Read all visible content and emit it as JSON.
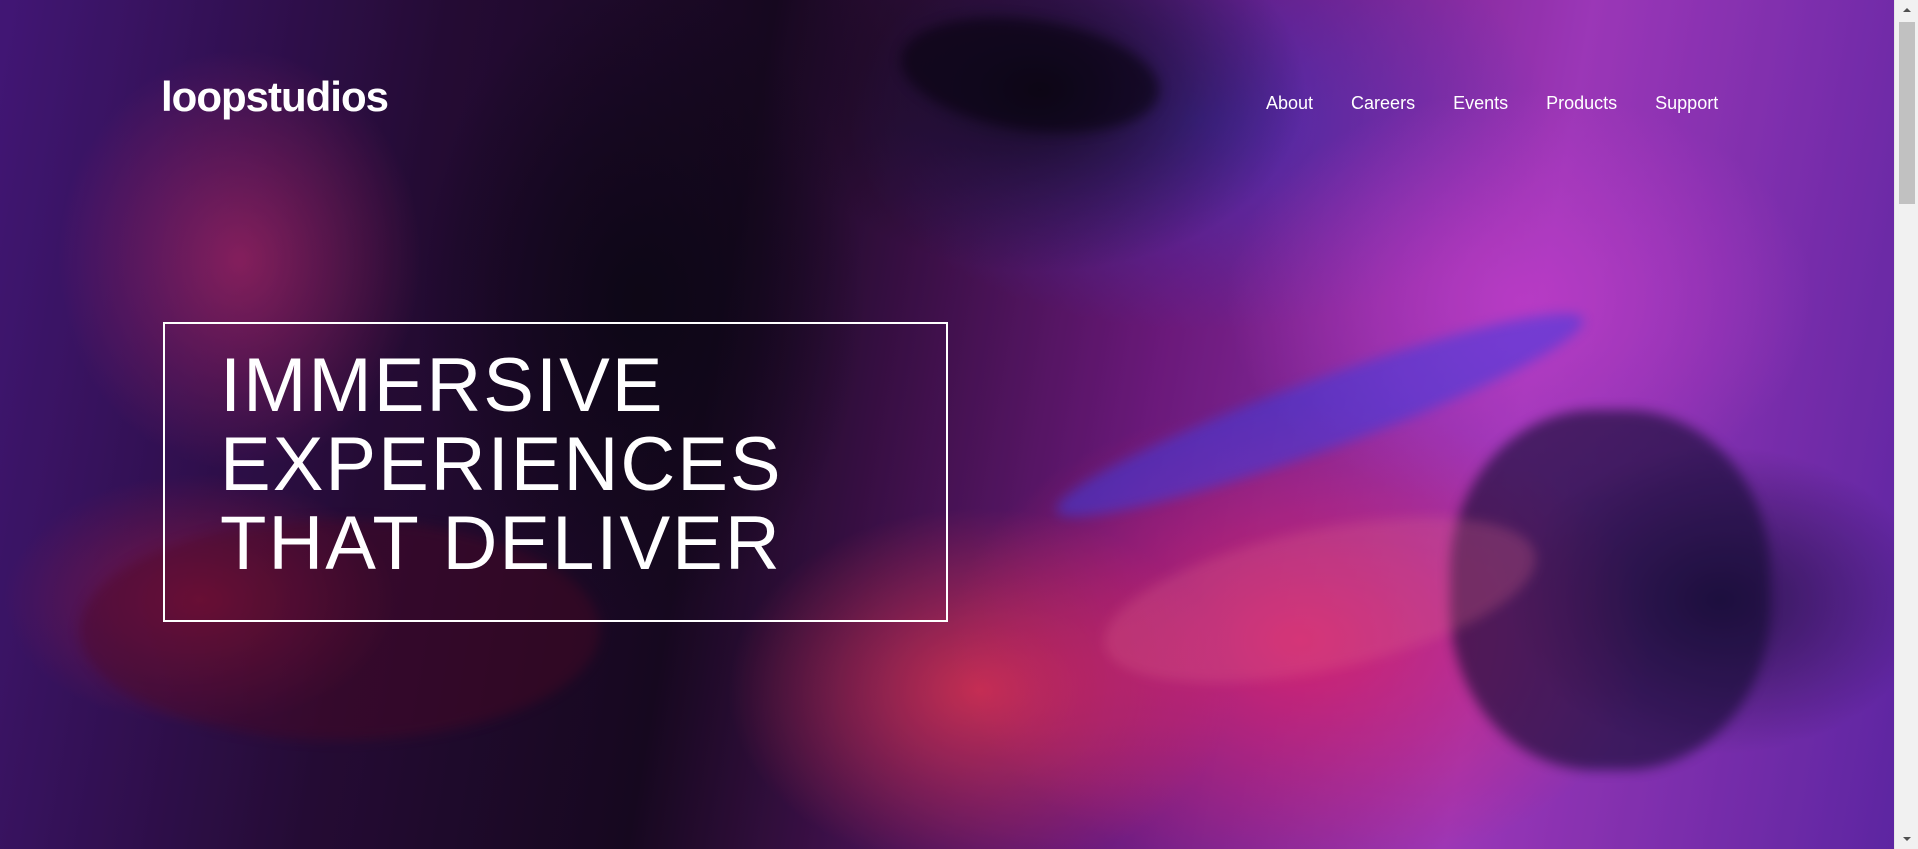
{
  "brand": {
    "logo": "loopstudios"
  },
  "nav": {
    "items": [
      {
        "label": "About"
      },
      {
        "label": "Careers"
      },
      {
        "label": "Events"
      },
      {
        "label": "Products"
      },
      {
        "label": "Support"
      }
    ]
  },
  "hero": {
    "headline_lines": [
      "IMMERSIVE",
      "EXPERIENCES",
      "THAT DELIVER"
    ]
  },
  "icons": {
    "scroll_up": "chevron-up-icon",
    "scroll_down": "chevron-down-icon"
  },
  "colors": {
    "text": "#ffffff",
    "scrollbar_track": "#f1f1f1",
    "scrollbar_thumb": "#c1c1c1"
  }
}
